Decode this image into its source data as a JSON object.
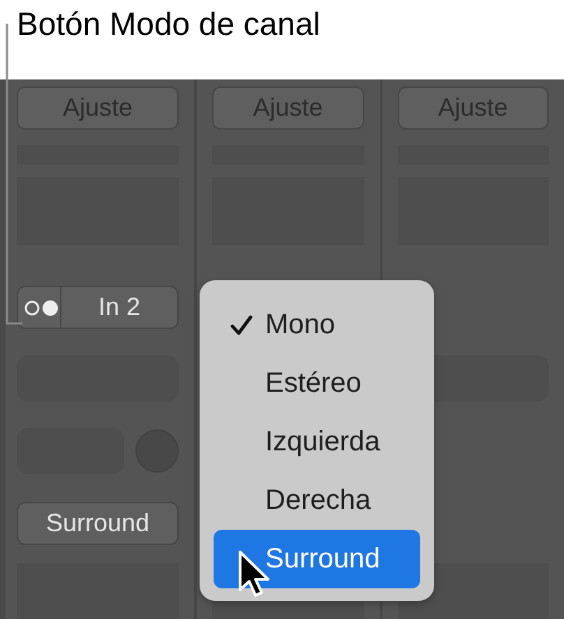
{
  "callout": {
    "label": "Botón Modo de canal"
  },
  "channels": [
    {
      "setting": "Ajuste",
      "input": "In 2",
      "format": "Surround"
    },
    {
      "setting": "Ajuste"
    },
    {
      "setting": "Ajuste"
    }
  ],
  "menu": {
    "items": [
      {
        "label": "Mono",
        "checked": true,
        "selected": false
      },
      {
        "label": "Estéreo",
        "checked": false,
        "selected": false
      },
      {
        "label": "Izquierda",
        "checked": false,
        "selected": false
      },
      {
        "label": "Derecha",
        "checked": false,
        "selected": false
      },
      {
        "label": "Surround",
        "checked": false,
        "selected": true
      }
    ]
  }
}
